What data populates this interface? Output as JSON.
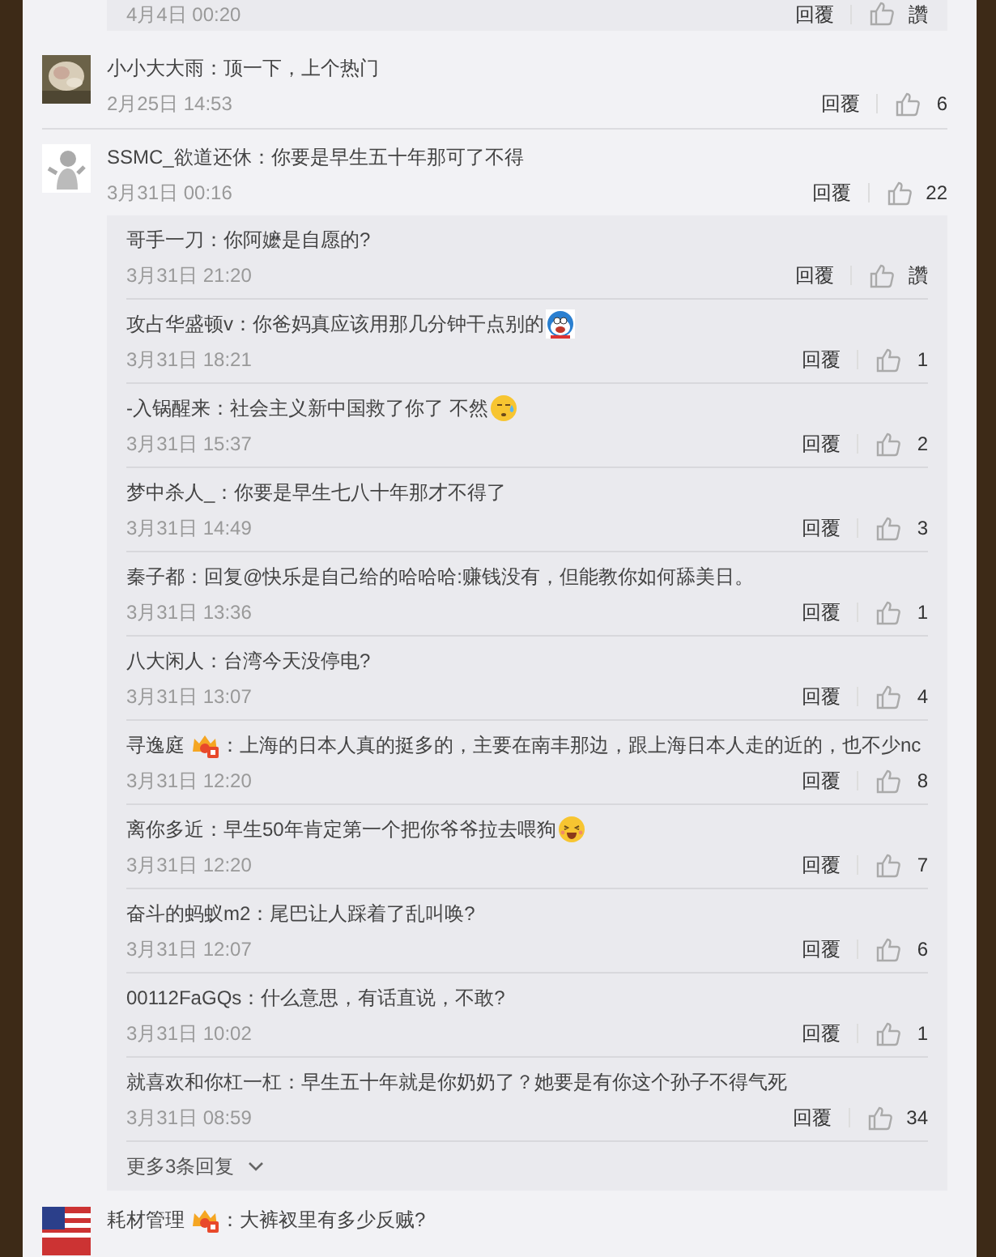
{
  "top_reply": {
    "date": "4月4日 00:20",
    "reply": "回覆",
    "likes": "讚"
  },
  "comments": [
    {
      "name": "小小大大雨",
      "kind": "plain",
      "text": "：顶一下，上个热门",
      "date": "2月25日 14:53",
      "reply": "回覆",
      "likes": "6"
    },
    {
      "avatar": {
        "kind": "figure"
      },
      "name": "SSMC_欲道还休",
      "kind": "plain",
      "text": "：你要是早生五十年那可了不得",
      "date": "3月31日 00:16",
      "reply": "回覆",
      "likes": "22",
      "replies": [
        {
          "name": "哥手一刀",
          "kind": "plain",
          "text": "：你阿嬷是自愿的?",
          "date": "3月31日 21:20",
          "reply": "回覆",
          "likes": "讚"
        },
        {
          "name": "攻占华盛顿v",
          "kind": "cat-emoji",
          "text": "：你爸妈真应该用那几分钟干点别的",
          "date": "3月31日 18:21",
          "reply": "回覆",
          "likes": "1"
        },
        {
          "name": "-入锅醒来",
          "kind": "sweat-emoji",
          "text": "：社会主义新中国救了你了 不然",
          "date": "3月31日 15:37",
          "reply": "回覆",
          "likes": "2"
        },
        {
          "name": "梦中杀人_",
          "kind": "plain",
          "text": "：你要是早生七八十年那才不得了",
          "date": "3月31日 14:49",
          "reply": "回覆",
          "likes": "3"
        },
        {
          "name": "秦子都",
          "kind": "plain",
          "text": "：回复@快乐是自己给的哈哈哈:赚钱没有，但能教你如何舔美日。",
          "date": "3月31日 13:36",
          "reply": "回覆",
          "likes": "1"
        },
        {
          "name": "八大闲人",
          "kind": "plain",
          "text": "：台湾今天没停电?",
          "date": "3月31日 13:07",
          "reply": "回覆",
          "likes": "4"
        },
        {
          "name": "寻逸庭",
          "kind": "badge",
          "text": "：上海的日本人真的挺多的，主要在南丰那边，跟上海日本人走的近的，也不少nc",
          "date": "3月31日 12:20",
          "reply": "回覆",
          "likes": "8"
        },
        {
          "name": "离你多近",
          "kind": "laugh-emoji",
          "text": "：早生50年肯定第一个把你爷爷拉去喂狗",
          "date": "3月31日 12:20",
          "reply": "回覆",
          "likes": "7"
        },
        {
          "name": "奋斗的蚂蚁m2",
          "kind": "plain",
          "text": "：尾巴让人踩着了乱叫唤?",
          "date": "3月31日 12:07",
          "reply": "回覆",
          "likes": "6"
        },
        {
          "name": "00112FaGQs",
          "kind": "plain",
          "text": "：什么意思，有话直说，不敢?",
          "date": "3月31日 10:02",
          "reply": "回覆",
          "likes": "1"
        },
        {
          "name": "就喜欢和你杠一杠",
          "kind": "plain",
          "text": "：早生五十年就是你奶奶了？她要是有你这个孙子不得气死",
          "date": "3月31日 08:59",
          "reply": "回覆",
          "likes": "34"
        }
      ],
      "more": "更多3条回复"
    },
    {
      "name": "耗材管理",
      "kind": "badge",
      "text": "：大裤衩里有多少反贼?"
    }
  ]
}
